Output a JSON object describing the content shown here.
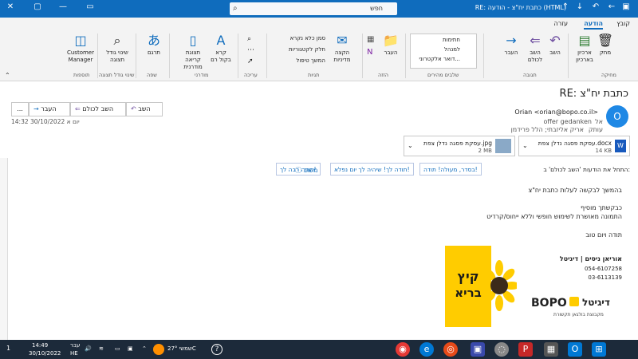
{
  "titlebar": {
    "title": "RE: כתבת יח\"צ - הודעה (HTML)",
    "search_placeholder": "חפש",
    "back_arrow": "←",
    "fwd_arrow": "→",
    "up_arrow": "↑",
    "down_arrow": "↓"
  },
  "ribbon_tabs": [
    "קובץ",
    "הודעה",
    "עזרה"
  ],
  "ribbon": {
    "delete_group": {
      "delete": "מחק",
      "archive": "ארכיון בארכיון",
      "label": "מחיקה"
    },
    "respond": {
      "reply": "השב",
      "reply_all": "השב לכולם",
      "forward": "העבר",
      "label": "תגובה"
    },
    "quick_steps": {
      "items": [
        "חתימות",
        "למנהל",
        "דואר אלקטרוני..."
      ],
      "label": "שלבים מהירים"
    },
    "move": {
      "move": "העבר",
      "label": "הזזה"
    },
    "tags": {
      "assign_policy": "הקצה מדיניות",
      "unread": "סמן כלא נקרא",
      "categorize": "חלק לקטגוריות",
      "followup": "המשך טיפול",
      "label": "תגיות"
    },
    "editing": {
      "label": "עריכה"
    },
    "immersive": {
      "read_aloud": "קרא בקול רם",
      "immersive_reader": "תצוגת קריאה מודרנית",
      "label": "מודרני"
    },
    "language": {
      "translate": "תרגם",
      "label": "שפה"
    },
    "zoom": {
      "zoom": "שינוי גודל תצוגה",
      "label": "שינוי גודל תצוגה"
    },
    "addin": {
      "customer_manager": "Customer Manager",
      "label": "תוספות"
    }
  },
  "message": {
    "subject": "RE: כתבת יח\"צ",
    "actions": {
      "reply": "השב",
      "reply_all": "השב לכולם",
      "forward": "העבר",
      "more": "..."
    },
    "sender_initial": "O",
    "from": "Orian <orian@bopo.co.il>",
    "to_label": "אל",
    "to": "offer gedanken",
    "cc_label": "עותק",
    "cc": "אריק אליזבתי; הלל פרידמן",
    "date": "יום א 30/10/2022 14:32",
    "attachments": [
      {
        "name": "עסקת פסגה נדלן צפת.docx",
        "size": "14 KB"
      },
      {
        "name": "עסקת פסגה נדלן צפת.jpg",
        "size": "2 MB"
      }
    ],
    "reply_prompt": "התחל את הודעות 'השב לכולם' ב:",
    "quick_replies": [
      "בסדר, מעולה! תודה!",
      "תודה לך! שיהיה לך יום נפלא!",
      "תודה רבה לך!"
    ],
    "feedback": "משוב",
    "body": [
      "בהמשך לבקשה לעלות כתבת יח\"צ",
      "כבקשתך מוסיף",
      "התמונה מאושרת לשימוש חופשי וללא ייחוס/קרדיט",
      "תודה ויום טוב"
    ],
    "signature": {
      "name": "אוריאן ניסים | דיגיטל",
      "phone1": "054-6107258",
      "phone2": "03-6113139",
      "brand_lettering": "BOPO דיגיטל",
      "brand_tagline": "מקבוצת בולגאן תקשורת",
      "banner_text": "קיץ בריא"
    }
  },
  "taskbar": {
    "weather": "שמשי 27°C",
    "time": "14:49",
    "date": "30/10/2022",
    "lang1": "עבר",
    "lang2": "HE",
    "notifications": "1"
  },
  "colors": {
    "accent": "#0f6cbd",
    "banner": "#ffcc00",
    "taskbar": "#1c2a3a"
  }
}
